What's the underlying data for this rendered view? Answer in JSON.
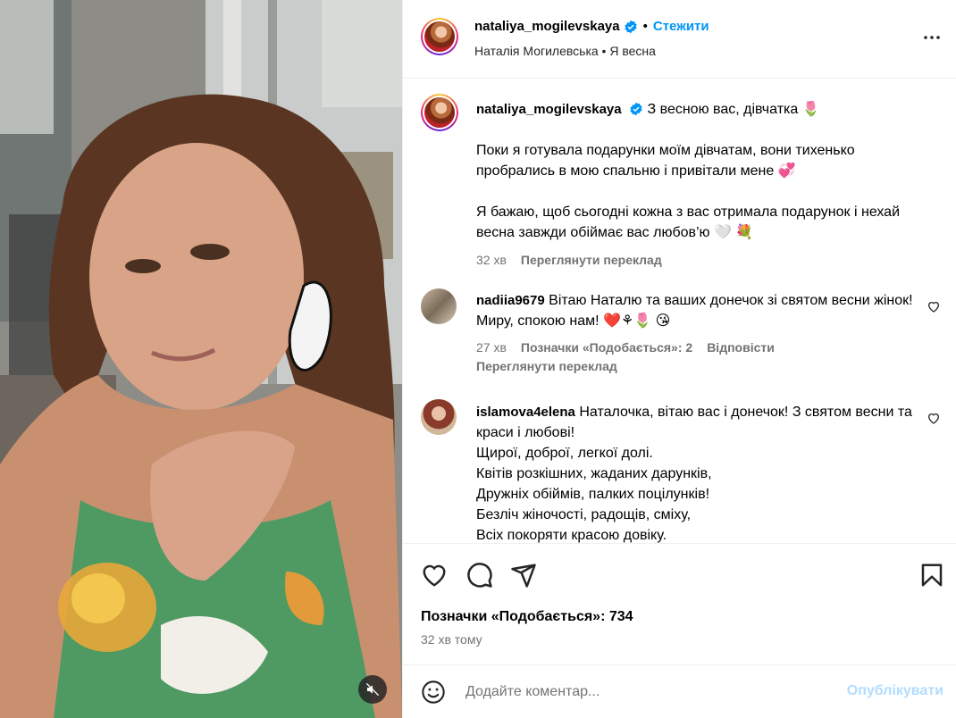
{
  "colors": {
    "accent": "#0095f6",
    "muted": "#737373",
    "publish_disabled": "#b3dbff"
  },
  "header": {
    "username": "nataliya_mogilevskaya",
    "separator": "•",
    "follow_label": "Стежити",
    "subtitle": "Наталія Могилевська • Я весна"
  },
  "caption": {
    "username": "nataliya_mogilevskaya",
    "title": "З весною вас, дівчатка 🌷",
    "paragraph1": "Поки я готувала подарунки моїм дівчатам, вони тихенько пробрались в мою спальню і привітали мене 💞",
    "paragraph2": "Я бажаю, щоб сьогодні кожна з вас отримала подарунок і нехай весна завжди обіймає вас любов’ю 🤍 💐",
    "time": "32 хв",
    "translate_label": "Переглянути переклад"
  },
  "comments": [
    {
      "username": "nadiia9679",
      "text": "Вітаю Наталю та ваших донечок зі святом весни жінок! Миру, спокою нам! ❤️⚘🌷 😘",
      "time": "27 хв",
      "likes_label": "Позначки «Подобається»: 2",
      "reply_label": "Відповісти",
      "translate_label": "Переглянути переклад"
    },
    {
      "username": "islamova4elena",
      "lines": [
        "Наталочка, вітаю вас і донечок! З святом весни та краси і любові!",
        "Щирої, доброї, легкої долі.",
        "Квітів розкішних, жаданих дарунків,",
        "Дружніх обіймів, палких поцілунків!",
        "Безліч жіночості, радощів, сміху,",
        "Всіх покоряти красою довіку."
      ]
    }
  ],
  "likes_text": "Позначки «Подобається»: 734",
  "posted_ago": "32 хв тому",
  "composer": {
    "placeholder": "Додайте коментар...",
    "publish_label": "Опублікувати"
  }
}
